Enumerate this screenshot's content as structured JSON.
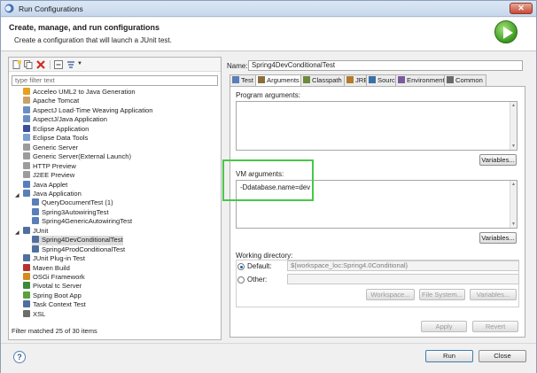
{
  "window": {
    "title": "Run Configurations",
    "close_glyph": "✕"
  },
  "banner": {
    "heading": "Create, manage, and run configurations",
    "subtitle": "Create a configuration that will launch a JUnit test."
  },
  "left": {
    "filter_placeholder": "type filter text",
    "tree": [
      {
        "label": "Acceleo UML2 to Java Generation",
        "icon_color": "#e6a020",
        "indent": 0
      },
      {
        "label": "Apache Tomcat",
        "icon_color": "#c8a26a",
        "indent": 0
      },
      {
        "label": "AspectJ Load-Time Weaving Application",
        "icon_color": "#6b8fc2",
        "indent": 0
      },
      {
        "label": "AspectJ/Java Application",
        "icon_color": "#6b8fc2",
        "indent": 0
      },
      {
        "label": "Eclipse Application",
        "icon_color": "#3b4f9a",
        "indent": 0
      },
      {
        "label": "Eclipse Data Tools",
        "icon_color": "#7aa0d0",
        "indent": 0
      },
      {
        "label": "Generic Server",
        "icon_color": "#9c9c9c",
        "indent": 0
      },
      {
        "label": "Generic Server(External Launch)",
        "icon_color": "#9c9c9c",
        "indent": 0
      },
      {
        "label": "HTTP Preview",
        "icon_color": "#9c9c9c",
        "indent": 0
      },
      {
        "label": "J2EE Preview",
        "icon_color": "#9c9c9c",
        "indent": 0
      },
      {
        "label": "Java Applet",
        "icon_color": "#5a7fb8",
        "indent": 0
      },
      {
        "label": "Java Application",
        "icon_color": "#5a7fb8",
        "indent": 0,
        "expanded": true
      },
      {
        "label": "QueryDocumentTest (1)",
        "icon_color": "#5a7fb8",
        "indent": 1
      },
      {
        "label": "Spring3AutowiringTest",
        "icon_color": "#5a7fb8",
        "indent": 1
      },
      {
        "label": "Spring4GenericAutowiringTest",
        "icon_color": "#5a7fb8",
        "indent": 1
      },
      {
        "label": "JUnit",
        "icon_color": "#4f6f9f",
        "indent": 0,
        "expanded": true
      },
      {
        "label": "Spring4DevConditionalTest",
        "icon_color": "#4f6f9f",
        "indent": 1,
        "selected": true
      },
      {
        "label": "Spring4ProdConditionalTest",
        "icon_color": "#4f6f9f",
        "indent": 1
      },
      {
        "label": "JUnit Plug-in Test",
        "icon_color": "#4f6f9f",
        "indent": 0
      },
      {
        "label": "Maven Build",
        "icon_color": "#b8322c",
        "indent": 0
      },
      {
        "label": "OSGi Framework",
        "icon_color": "#d48a1c",
        "indent": 0
      },
      {
        "label": "Pivotal tc Server",
        "icon_color": "#3b8b3b",
        "indent": 0
      },
      {
        "label": "Spring Boot App",
        "icon_color": "#5aa03c",
        "indent": 0
      },
      {
        "label": "Task Context Test",
        "icon_color": "#4f6f9f",
        "indent": 0
      },
      {
        "label": "XSL",
        "icon_color": "#6c6c6c",
        "indent": 0
      }
    ],
    "status": "Filter matched 25 of 30 items"
  },
  "right": {
    "name_label": "Name:",
    "name_value": "Spring4DevConditionalTest",
    "tabs": [
      {
        "label": "Test",
        "icon": "test-icon"
      },
      {
        "label": "Arguments",
        "icon": "arguments-icon",
        "active": true
      },
      {
        "label": "Classpath",
        "icon": "classpath-icon"
      },
      {
        "label": "JRE",
        "icon": "jre-icon"
      },
      {
        "label": "Source",
        "icon": "source-icon"
      },
      {
        "label": "Environment",
        "icon": "environment-icon"
      },
      {
        "label": "Common",
        "icon": "common-icon"
      }
    ],
    "program_args_label": "Program arguments:",
    "program_args_value": "",
    "vm_args_label": "VM arguments:",
    "vm_args_value": "-Ddatabase.name=dev",
    "variables_button": "Variables...",
    "working_dir_label": "Working directory:",
    "default_label": "Default:",
    "default_value": "${workspace_loc:Spring4.0Conditional}",
    "other_label": "Other:",
    "workspace_button": "Workspace...",
    "filesystem_button": "File System...",
    "variables_button_small": "Variables...",
    "apply_button": "Apply",
    "revert_button": "Revert"
  },
  "footer": {
    "help": "?",
    "run_button": "Run",
    "close_button": "Close"
  },
  "colors": {
    "highlight": "#48c748",
    "accent": "#1f5fb5"
  }
}
